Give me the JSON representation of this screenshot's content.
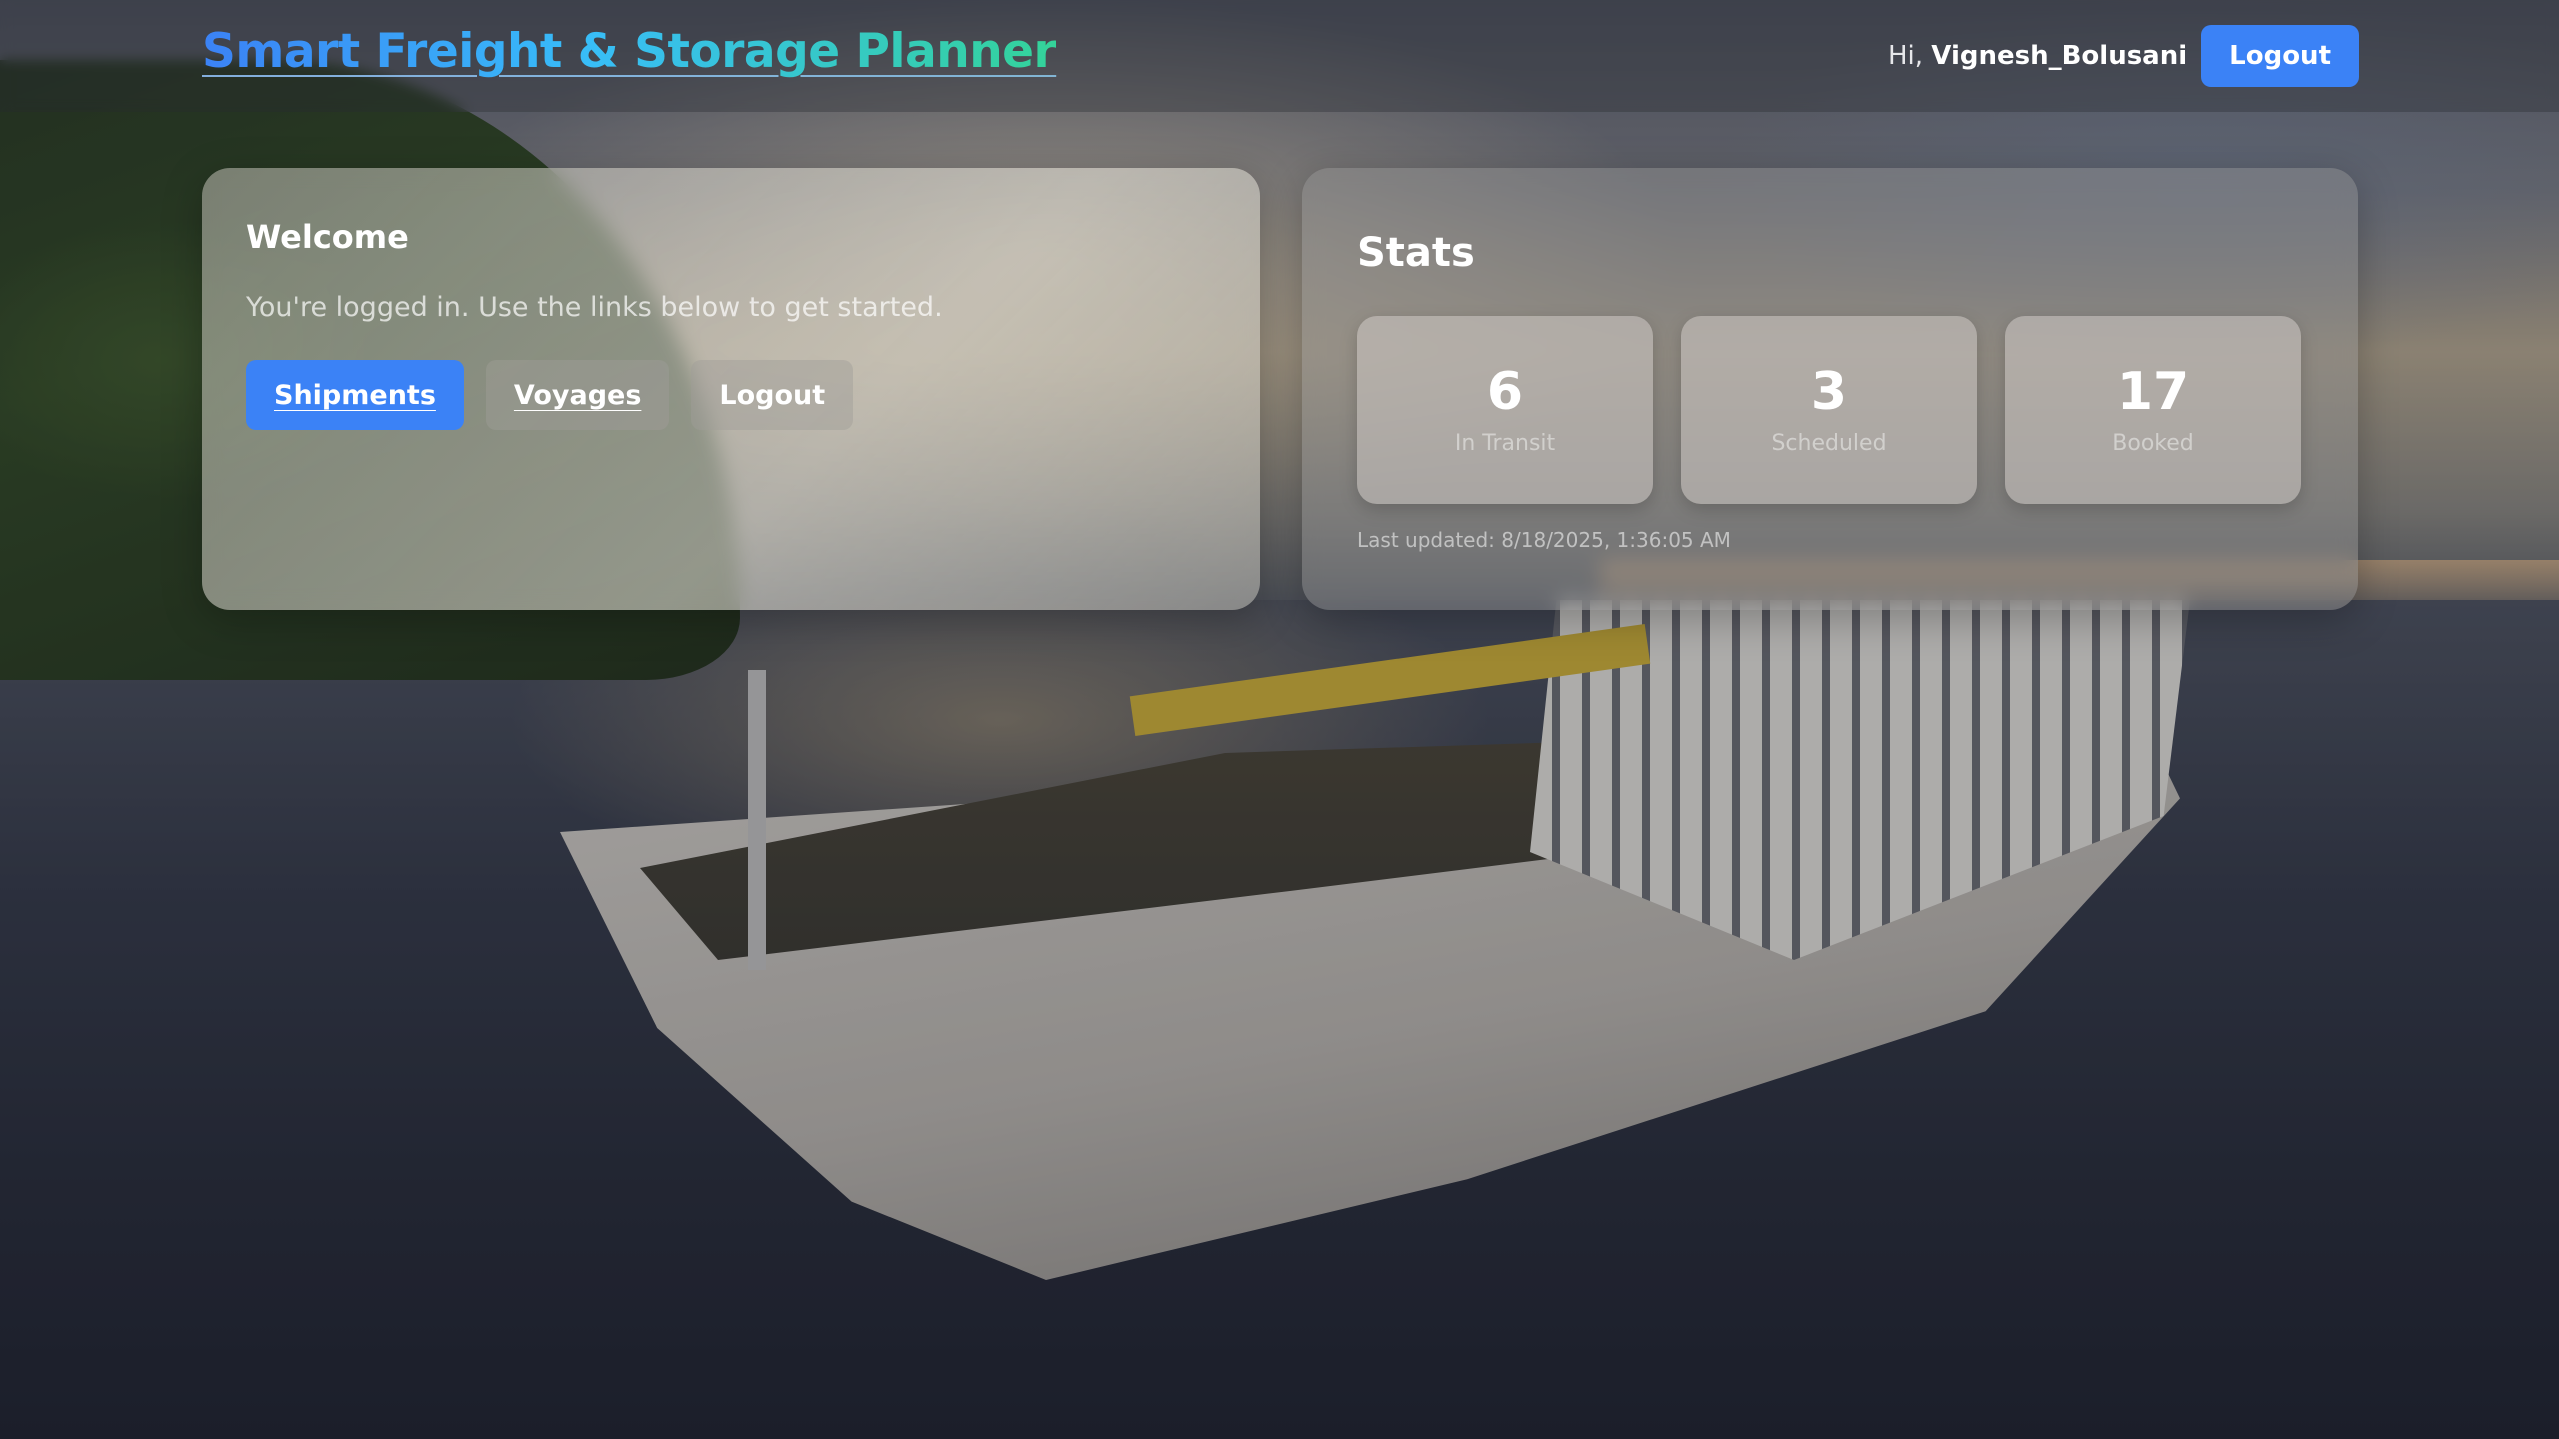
{
  "header": {
    "brand": "Smart Freight & Storage Planner",
    "greeting_prefix": "Hi,",
    "username": "Vignesh_Bolusani",
    "logout_label": "Logout"
  },
  "welcome": {
    "title": "Welcome",
    "text": "You're logged in. Use the links below to get started.",
    "buttons": {
      "shipments": "Shipments",
      "voyages": "Voyages",
      "logout": "Logout"
    }
  },
  "stats": {
    "title": "Stats",
    "tiles": [
      {
        "value": "6",
        "label": "In Transit"
      },
      {
        "value": "3",
        "label": "Scheduled"
      },
      {
        "value": "17",
        "label": "Booked"
      }
    ],
    "last_updated": "Last updated: 8/18/2025, 1:36:05 AM"
  },
  "colors": {
    "accent": "#3b82f6",
    "brand_gradient_start": "#3b82f6",
    "brand_gradient_end": "#34d399"
  }
}
